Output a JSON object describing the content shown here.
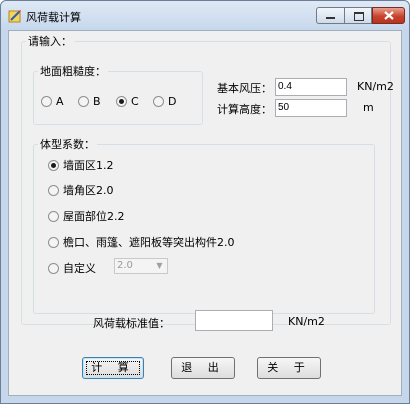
{
  "window": {
    "title": "风荷载计算"
  },
  "input_group": {
    "legend": "请输入："
  },
  "roughness": {
    "legend": "地面粗糙度：",
    "options": [
      {
        "label": "A",
        "selected": false
      },
      {
        "label": "B",
        "selected": false
      },
      {
        "label": "C",
        "selected": true
      },
      {
        "label": "D",
        "selected": false
      }
    ]
  },
  "basic_pressure": {
    "label": "基本风压：",
    "value": "0.4",
    "unit": "KN/m2"
  },
  "calc_height": {
    "label": "计算高度：",
    "value": "50",
    "unit": "m"
  },
  "shape_coef": {
    "legend": "体型系数：",
    "options": [
      {
        "label": "墙面区1.2",
        "selected": true
      },
      {
        "label": "墙角区2.0",
        "selected": false
      },
      {
        "label": "屋面部位2.2",
        "selected": false
      },
      {
        "label": "檐口、雨篷、遮阳板等突出构件2.0",
        "selected": false
      },
      {
        "label": "自定义",
        "selected": false
      }
    ],
    "custom_value": "2.0"
  },
  "result": {
    "label": "风荷载标准值：",
    "value": "",
    "unit": "KN/m2"
  },
  "buttons": {
    "calc": "计 算",
    "exit": "退 出",
    "about": "关 于"
  }
}
